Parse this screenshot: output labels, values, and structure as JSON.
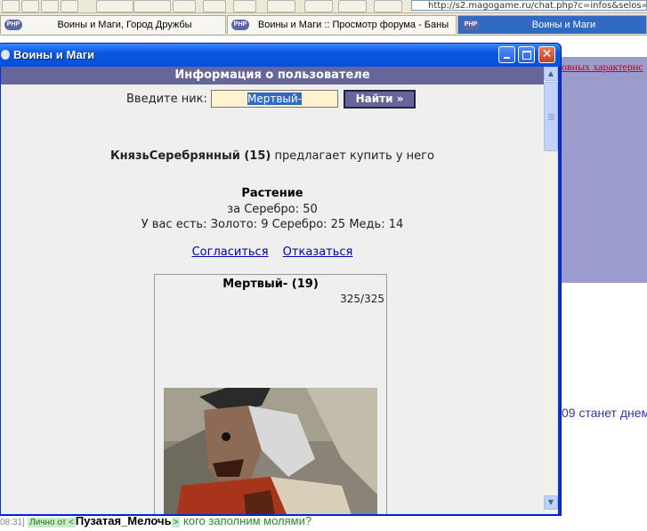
{
  "browser": {
    "address_text": "http://s2.magogame.ru/chat.php?c=infos&selos=",
    "tabs": [
      {
        "label": "Воины и Маги, Город Дружбы",
        "icon": "php-icon",
        "active": false
      },
      {
        "label": "Воины и Маги :: Просмотр форума - Баны",
        "icon": "php-icon",
        "active": false
      },
      {
        "label": "Воины и Маги",
        "icon": "php-icon",
        "active": true
      }
    ]
  },
  "background_page": {
    "red_link": "овных характерис",
    "blue_text": "09 станет днем",
    "chat": {
      "time": "08:31]",
      "private_tag": "Лично от <",
      "nick": "Пузатая_Мелочь",
      "close_tag": ">",
      "message": " кого заполним молями?"
    }
  },
  "popup": {
    "title": "Воины и Маги",
    "header": "Информация о пользователе",
    "search": {
      "label": "Введите ник:",
      "value": "Мертвый-",
      "button": "Найти »"
    },
    "offer": {
      "seller": "КнязьСеребрянный (15)",
      "text": " предлагает купить у него"
    },
    "item": {
      "name": "Растение",
      "price_line": "за Серебро: 50",
      "have_line": "У вас есть: Золото: 9 Серебро: 25 Медь: 14"
    },
    "actions": {
      "accept": "Согласиться",
      "decline": "Отказаться"
    },
    "character": {
      "name": "Мертвый- (19)",
      "hp": "325/325"
    }
  },
  "colors": {
    "header_bar": "#666699",
    "link": "#0000aa",
    "input_bg": "#fff3cf",
    "title_bar": "#0a58e0"
  }
}
